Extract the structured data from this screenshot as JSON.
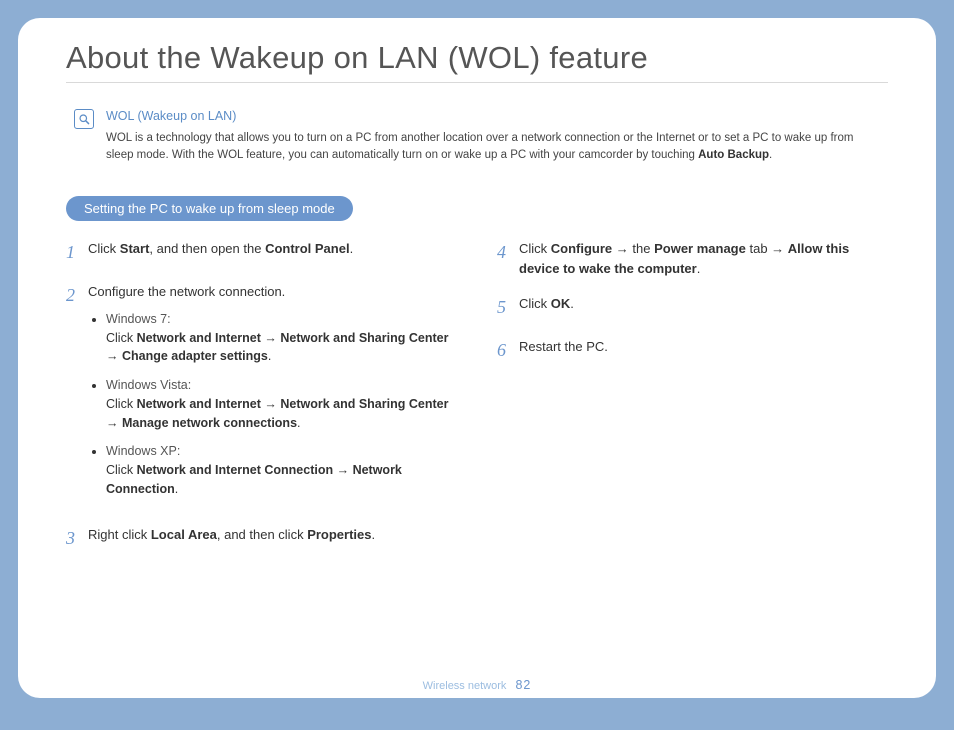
{
  "title": "About the Wakeup on LAN (WOL) feature",
  "info": {
    "heading": "WOL (Wakeup on LAN)",
    "body_pre": "WOL is a technology  that allows you to turn on a PC from another location over a network connection or the Internet or to set a PC to wake up from sleep mode. With the WOL feature, you can automatically turn on or wake up a PC with your camcorder by touching ",
    "body_bold": "Auto Backup",
    "body_post": "."
  },
  "section_pill": "Setting the PC to wake up from sleep mode",
  "steps_left": [
    {
      "num": "1",
      "html": "Click <b>Start</b>, and then open the <b>Control Panel</b>."
    },
    {
      "num": "2",
      "text": "Configure the network connection.",
      "bullets": [
        {
          "os": "Windows 7:",
          "path": "Click <b>Network and Internet</b> → <b>Network and Sharing Center</b> → <b>Change adapter settings</b>."
        },
        {
          "os": "Windows Vista:",
          "path": "Click <b>Network and Internet</b> → <b>Network and Sharing Center</b> → <b>Manage network connections</b>."
        },
        {
          "os": "Windows XP:",
          "path": "Click <b>Network and Internet Connection</b> → <b>Network Connection</b>."
        }
      ]
    },
    {
      "num": "3",
      "html": "Right click <b>Local Area</b>, and then click <b>Properties</b>."
    }
  ],
  "steps_right": [
    {
      "num": "4",
      "html": "Click <b>Configure</b> → the <b>Power manage</b> tab → <b>Allow this device to wake the computer</b>."
    },
    {
      "num": "5",
      "html": "Click <b>OK</b>."
    },
    {
      "num": "6",
      "html": "Restart the PC."
    }
  ],
  "footer": {
    "section": "Wireless network",
    "page": "82"
  }
}
